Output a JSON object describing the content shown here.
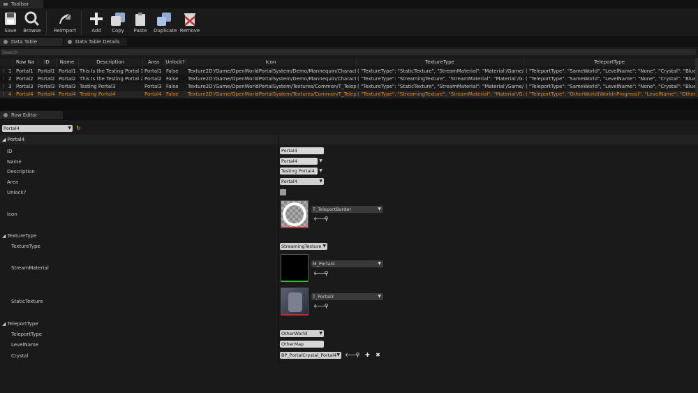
{
  "toolbar_tab": {
    "label": "Toolbar"
  },
  "toolbar": {
    "save": "Save",
    "browse": "Browse",
    "reimport": "Reimport",
    "add": "Add",
    "copy": "Copy",
    "paste": "Paste",
    "duplicate": "Duplicate",
    "remove": "Remove"
  },
  "tabs": {
    "data_table": "Data Table",
    "details": "Data Table Details",
    "row_editor": "Row Editor"
  },
  "search": {
    "placeholder": "Search"
  },
  "columns": [
    "Row Na",
    "ID",
    "Name",
    "Description",
    "Area",
    "Unlock?",
    "Icon",
    "TextureType",
    "TeleportType"
  ],
  "rows": [
    {
      "num": "1",
      "row_name": "Portal1",
      "id": "Portal1",
      "name": "Portal1",
      "description": "This Is the Testing Portal 1",
      "area": "Portal1",
      "unlock": "False",
      "icon": "Texture2D'/Game/OpenWorldPortalSystem/Demo/Mannequin/Character,",
      "texture_type": "( \"TextureType\": \"StaticTexture\", \"StreamMaterial\": \"Material'/Game/OpenW",
      "teleport_type": "( \"TeleportType\": \"SameWorld\", \"LevelName\": \"None\", \"Crystal\": \"BlueprintG"
    },
    {
      "num": "2",
      "row_name": "Portal2",
      "id": "Portal2",
      "name": "Portal2",
      "description": "This Is the Testing Portal 2",
      "area": "Portal2",
      "unlock": "False",
      "icon": "Texture2D'/Game/OpenWorldPortalSystem/Demo/Mannequin/Character,",
      "texture_type": "( \"TextureType\": \"StreamingTexture\", \"StreamMaterial\": \"Material'/Game/O",
      "teleport_type": "( \"TeleportType\": \"SameWorld\", \"LevelName\": \"None\", \"Crystal\": \"BlueprintG"
    },
    {
      "num": "3",
      "row_name": "Portal3",
      "id": "Portal3",
      "name": "Portal3",
      "description": "Testing Portal3",
      "area": "Portal3",
      "unlock": "False",
      "icon": "Texture2D'/Game/OpenWorldPortalSystem/Textures/Common/T_Telepor",
      "texture_type": "( \"TextureType\": \"StaticTexture\", \"StreamMaterial\": \"Material'/Game/OpenW",
      "teleport_type": "( \"TeleportType\": \"SameWorld\", \"LevelName\": \"None\", \"Crystal\": \"BlueprintG"
    },
    {
      "num": "4",
      "row_name": "Portal4",
      "id": "Portal4",
      "name": "Portal4",
      "description": "Testing Portal4",
      "area": "Portal4",
      "unlock": "False",
      "icon": "Texture2D'/Game/OpenWorldPortalSystem/Textures/Common/T_Telepor",
      "texture_type": "( \"TextureType\": \"StreamingTexture\", \"StreamMaterial\": \"Material'/Game/O",
      "teleport_type": "( \"TeleportType\": \"OtherWorld(WorkInProgress)\", \"LevelName\": \"OtherMap\","
    }
  ],
  "row_editor": {
    "selector": "Portal4",
    "section_title": "Portal4",
    "labels": {
      "id": "ID",
      "name": "Name",
      "description": "Description",
      "area": "Area",
      "unlock": "Unlock?",
      "icon": "Icon",
      "texture_group": "TextureType",
      "texture_type": "TextureType",
      "stream_material": "StreamMaterial",
      "static_texture": "StaticTexture",
      "teleport_group": "TeleportType",
      "teleport_type": "TeleportType",
      "level_name": "LevelName",
      "crystal": "Crystal"
    },
    "values": {
      "id": "Portal4",
      "name": "Portal4",
      "description": "Testing Portal4",
      "area": "Portal4",
      "icon_asset": "T_TeleportBorder",
      "texture_type": "StreamingTexture",
      "stream_material": "M_Portal4",
      "static_texture": "T_Portal3",
      "teleport_type": "OtherWorld",
      "level_name": "OtherMap",
      "crystal": "BP_PortalCrystal_Portal4"
    }
  },
  "colors": {
    "selected_row": "#e08a1e",
    "accent": "#e08a1e"
  }
}
